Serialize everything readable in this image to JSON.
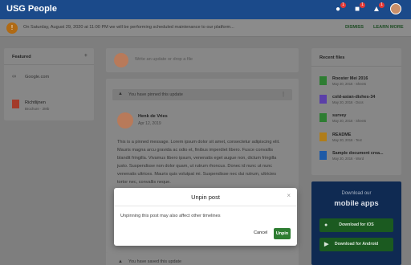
{
  "app": {
    "title": "USG People"
  },
  "topbar": {
    "badges": [
      "1",
      "1",
      "1"
    ]
  },
  "announcement": {
    "text": "On Saturday, August 29, 2020 at 11:00 PM we will be performing scheduled maintenance to our platform...",
    "dismiss_label": "DISMISS",
    "learn_more_label": "LEARN MORE"
  },
  "featured": {
    "title": "Featured",
    "add": "+",
    "items": [
      {
        "label": "Google.com"
      },
      {
        "label": "Richtlijnen",
        "meta": "Brochure · 2Mb"
      }
    ]
  },
  "composer": {
    "placeholder": "Write an update or drop a file"
  },
  "post": {
    "pinned_notice": "You have pinned this update",
    "author": "Henk de Vries",
    "date": "Apr 12, 2019",
    "body": "This is a pinned message. Lorem ipsum dolor sit amet, consectetur adipiscing elit. Mauris magna arcu gravida ac odio et, finibus imperdiet libero. Fusce convallis blandit fringilla. Vivamus libero ipsum, venenatis eget augue non, dictum fringilla justo. Suspendisse non dolor quam, ut rutrum rhoncus. Donec id nunc ut nunc venenatis ultrices. Mauris quis volutpat mi. Suspendisse nec dui rutrum, ultricies tortor nec, convallis neque."
  },
  "second_post": {
    "notice": "You have saved this update"
  },
  "recent_files": {
    "title": "Recent files",
    "files": [
      {
        "name": "Rooster Mei 2016",
        "meta": "May 20, 2016 · Sheets",
        "color": "#2e7d32"
      },
      {
        "name": "cold-asian-dishes-34",
        "meta": "May 20, 2016 · Docs",
        "color": "#5b3fa8"
      },
      {
        "name": "survey",
        "meta": "May 20, 2016 · Sheets",
        "color": "#2e7d32"
      },
      {
        "name": "README",
        "meta": "May 20, 2016 · Text",
        "color": "#b07d1a"
      },
      {
        "name": "Sample document crea...",
        "meta": "May 20, 2016 · Word",
        "color": "#1e5aa6"
      }
    ]
  },
  "mobile": {
    "subtitle": "Download our",
    "title": "mobile apps",
    "ios_label": "Download for iOS",
    "android_label": "Download for Android"
  },
  "modal": {
    "title": "Unpin post",
    "close": "×",
    "message": "Unpinning this post may also affect other timelines",
    "cancel_label": "Cancel",
    "confirm_label": "Unpin"
  }
}
